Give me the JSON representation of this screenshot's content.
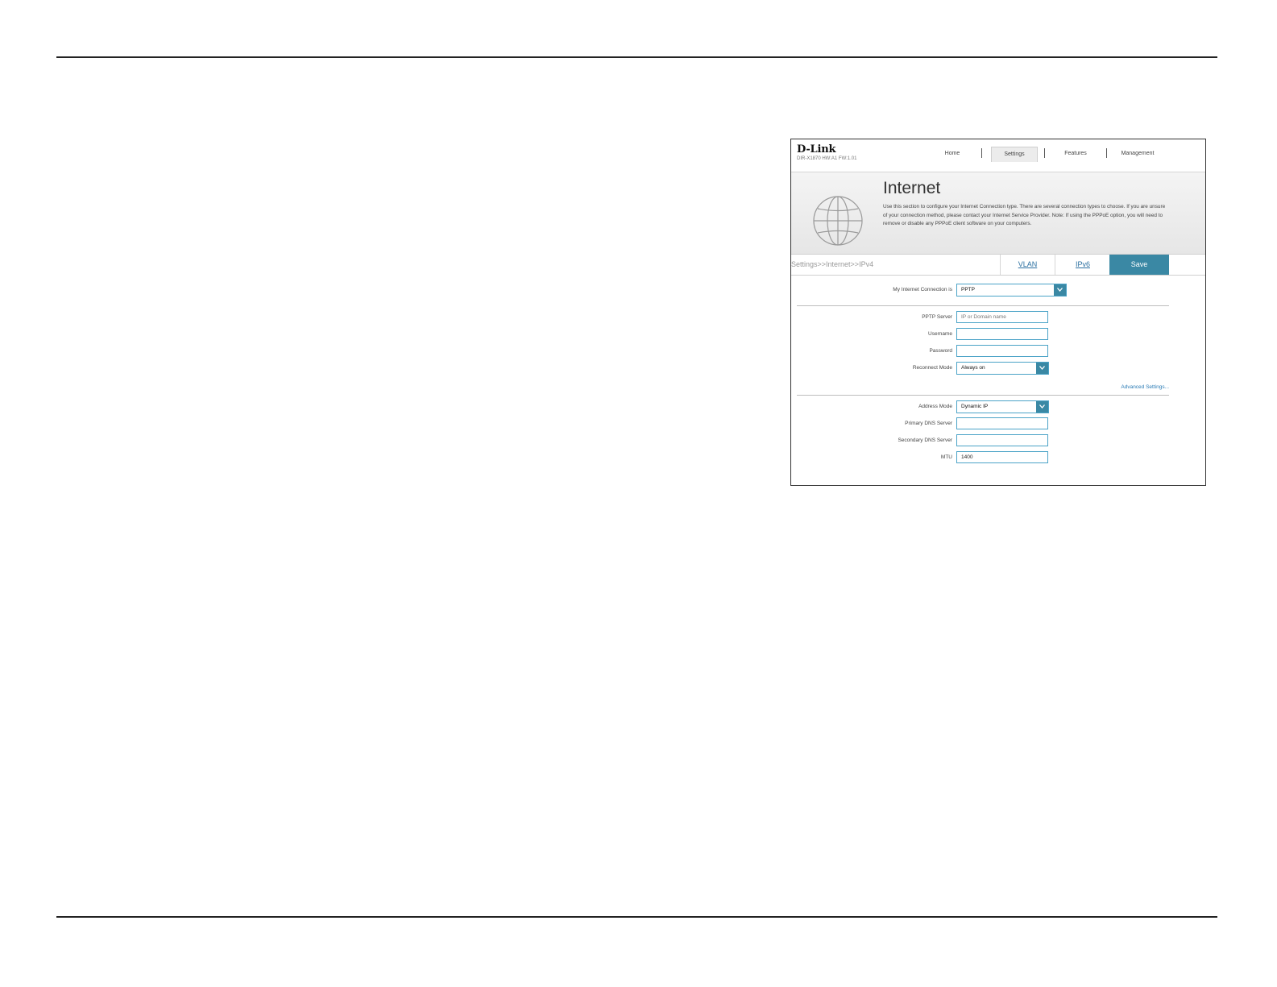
{
  "header": {
    "brand": "D-Link",
    "firmware": "DIR-X1870 HW:A1 FW:1.01",
    "nav": [
      "Home",
      "Settings",
      "Features",
      "Management"
    ],
    "active_nav": "Settings"
  },
  "banner": {
    "title": "Internet",
    "description": "Use this section to configure your Internet Connection type. There are several connection types to choose. If you are unsure of your connection method, please contact your Internet Service Provider. Note: If using the PPPoE option, you will need to remove or disable any PPPoE client software on your computers.",
    "icon": "globe-icon"
  },
  "subbar": {
    "breadcrumb": "Settings>>Internet>>IPv4",
    "tab_vlan": "VLAN",
    "tab_ipv6": "IPv6",
    "save": "Save"
  },
  "form": {
    "connection_label": "My Internet Connection is",
    "connection_value": "PPTP",
    "pptp_server_label": "PPTP Server",
    "pptp_server_placeholder": "IP or Domain name",
    "username_label": "Username",
    "password_label": "Password",
    "reconnect_label": "Reconnect Mode",
    "reconnect_value": "Always on",
    "advanced_link": "Advanced Settings...",
    "address_mode_label": "Address Mode",
    "address_mode_value": "Dynamic IP",
    "primary_dns_label": "Primary DNS Server",
    "secondary_dns_label": "Secondary DNS Server",
    "mtu_label": "MTU",
    "mtu_value": "1400"
  },
  "colors": {
    "accent": "#3a88a4",
    "input_border": "#4ba3c7",
    "link": "#2a6fa0"
  }
}
